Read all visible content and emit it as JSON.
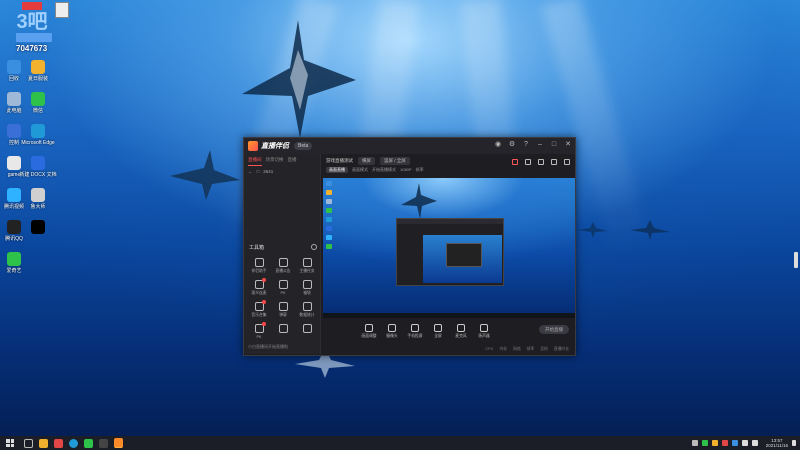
{
  "desktop": {
    "badge": {
      "logo_text": "3吧",
      "name_label": "",
      "number": "7047673",
      "corner_label": ""
    },
    "icons": [
      {
        "label": "回收",
        "color": "#3b8fe0",
        "icon": "recycle-bin-icon"
      },
      {
        "label": "夏日服装",
        "color": "#f2b22e",
        "icon": "folder-icon"
      },
      {
        "label": "此电脑",
        "color": "#9fb8d8",
        "icon": "computer-icon"
      },
      {
        "label": "微信",
        "color": "#2ec24a",
        "icon": "wechat-icon"
      },
      {
        "label": "控制",
        "color": "#3a6fd8",
        "icon": "control-panel-icon"
      },
      {
        "label": "Microsoft Edge",
        "color": "#1f9ad6",
        "icon": "edge-icon"
      },
      {
        "label": "game",
        "color": "#e8e8e8",
        "icon": "file-icon"
      },
      {
        "label": "新建 DOCX 文档",
        "color": "#2b6be0",
        "icon": "docx-icon"
      },
      {
        "label": "腾讯视频",
        "color": "#2fb2ff",
        "icon": "video-icon"
      },
      {
        "label": "鲁大师",
        "color": "#d0d0d0",
        "icon": "app-icon"
      },
      {
        "label": "腾讯QQ",
        "color": "#222222",
        "icon": "qq-icon"
      },
      {
        "label": "",
        "color": "#000000",
        "icon": "blank-icon"
      },
      {
        "label": "爱奇艺",
        "color": "#2ec24a",
        "icon": "iqiyi-icon"
      }
    ]
  },
  "app": {
    "name": "直播伴侣",
    "chip": "Beta",
    "left": {
      "tabs": [
        "直播间",
        "场景切换",
        "直播"
      ],
      "sub": [
        "←",
        "□",
        "2641"
      ],
      "tools_label": "工具箱",
      "tools": [
        {
          "label": "伴侣助手",
          "red": false
        },
        {
          "label": "直播公告",
          "red": false
        },
        {
          "label": "主播任务",
          "red": false
        },
        {
          "label": "观众连麦",
          "red": true
        },
        {
          "label": "PK",
          "red": false
        },
        {
          "label": "福袋",
          "red": false
        },
        {
          "label": "音乐合集",
          "red": true
        },
        {
          "label": "弹幕",
          "red": false
        },
        {
          "label": "数据统计",
          "red": false
        },
        {
          "label": "PK",
          "red": true
        },
        {
          "label": "",
          "red": false
        },
        {
          "label": "",
          "red": false
        }
      ],
      "footer": "小白直播间开始直播啦"
    },
    "right": {
      "row1": [
        "游戏直播测试",
        "横屏",
        "竖屏 / 全屏"
      ],
      "row2": [
        "画面直播",
        "画面模式",
        "开始直播模式",
        "1080P",
        "帧率"
      ],
      "controls": [
        {
          "label": "画面调整"
        },
        {
          "label": "摄像头"
        },
        {
          "label": "手机投屏"
        },
        {
          "label": "全屏"
        },
        {
          "label": "麦克风"
        },
        {
          "label": "扬声器"
        }
      ],
      "start_label": "开始直播",
      "status": [
        "CPU",
        "内存",
        "网络",
        "帧率",
        "丢帧",
        "直播时长"
      ]
    }
  },
  "taskbar": {
    "clock_time": "13:57",
    "clock_date": "2021/11/16"
  }
}
